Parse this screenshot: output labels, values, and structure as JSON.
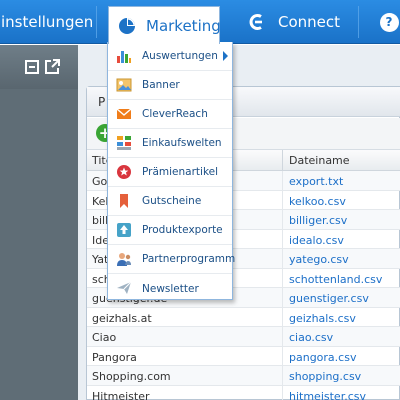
{
  "nav": {
    "einstellungen_label": "instellungen",
    "marketing_label": "Marketing",
    "connect_label": "Connect",
    "help_label": "?"
  },
  "side_panel": {
    "icons": [
      "collapse-icon",
      "popout-icon"
    ]
  },
  "panel": {
    "title": "P",
    "add_button": "+"
  },
  "marketing_menu": {
    "items": [
      {
        "label": "Auswertungen",
        "icon": "bar-chart-icon",
        "submenu": true
      },
      {
        "label": "Banner",
        "icon": "banner-image-icon"
      },
      {
        "label": "CleverReach",
        "icon": "envelope-icon"
      },
      {
        "label": "Einkaufswelten",
        "icon": "tiles-icon"
      },
      {
        "label": "Prämienartikel",
        "icon": "award-seal-icon"
      },
      {
        "label": "Gutscheine",
        "icon": "bookmark-icon"
      },
      {
        "label": "Produktexporte",
        "icon": "export-icon"
      },
      {
        "label": "Partnerprogramm",
        "icon": "partner-user-icon"
      },
      {
        "label": "Newsletter",
        "icon": "paper-plane-icon"
      }
    ]
  },
  "table": {
    "headers": {
      "title": "Tite",
      "filename": "Dateiname"
    },
    "rows": [
      {
        "title": "Go",
        "file": "export.txt"
      },
      {
        "title": "Kel",
        "file": "kelkoo.csv"
      },
      {
        "title": "billi",
        "file": "billiger.csv"
      },
      {
        "title": "Ide",
        "file": "idealo.csv"
      },
      {
        "title": "Yat",
        "file": "yatego.csv"
      },
      {
        "title": "sch",
        "file": "schottenland.csv"
      },
      {
        "title": "guenstiger.de",
        "file": "guenstiger.csv"
      },
      {
        "title": "geizhals.at",
        "file": "geizhals.csv"
      },
      {
        "title": "Ciao",
        "file": "ciao.csv"
      },
      {
        "title": "Pangora",
        "file": "pangora.csv"
      },
      {
        "title": "Shopping.com",
        "file": "shopping.csv"
      },
      {
        "title": "Hitmeister",
        "file": "hitmeister.csv"
      }
    ]
  },
  "colors": {
    "nav_blue": "#1a72c8",
    "link_blue": "#1c6fc8",
    "side_gray": "#5f6d76"
  }
}
